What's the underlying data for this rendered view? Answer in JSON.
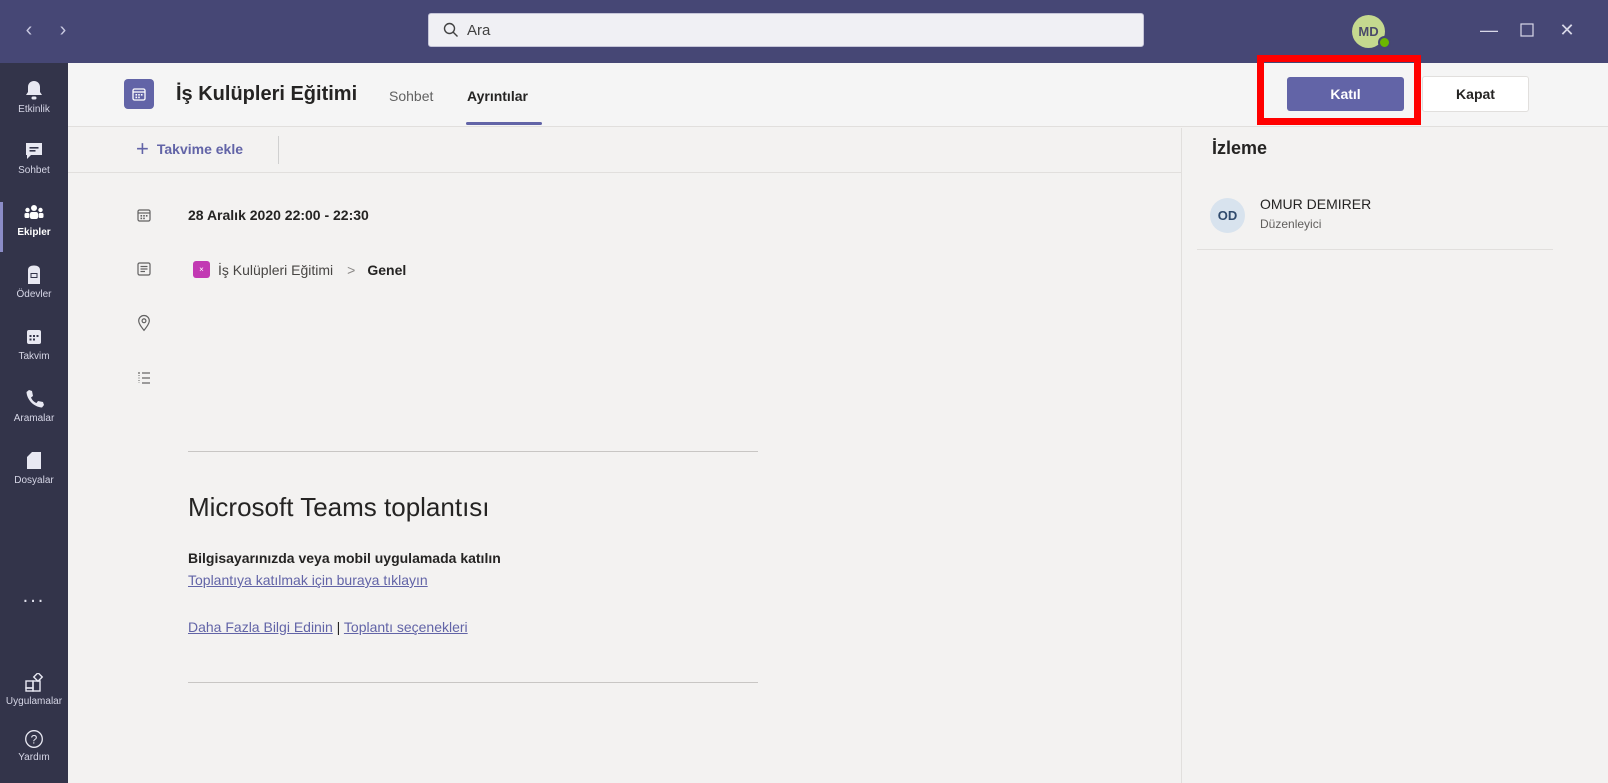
{
  "titlebar": {
    "search_placeholder": "Ara",
    "avatar_initials": "MD"
  },
  "rail": {
    "items": [
      {
        "label": "Etkinlik",
        "icon": "bell-icon"
      },
      {
        "label": "Sohbet",
        "icon": "chat-icon"
      },
      {
        "label": "Ekipler",
        "icon": "teams-icon",
        "active": true
      },
      {
        "label": "Ödevler",
        "icon": "assignments-icon"
      },
      {
        "label": "Takvim",
        "icon": "calendar-icon"
      },
      {
        "label": "Aramalar",
        "icon": "phone-icon"
      },
      {
        "label": "Dosyalar",
        "icon": "file-icon"
      }
    ],
    "more": "...",
    "apps_label": "Uygulamalar",
    "help_label": "Yardım"
  },
  "header": {
    "title": "İş Kulüpleri Eğitimi",
    "tabs": [
      "Sohbet",
      "Ayrıntılar"
    ],
    "active_tab": "Ayrıntılar",
    "join_label": "Katıl",
    "close_label": "Kapat"
  },
  "toolbar": {
    "add_calendar_label": "Takvime ekle"
  },
  "details": {
    "datetime": "28 Aralık 2020 22:00 - 22:30",
    "team_name": "İş Kulüpleri Eğitimi",
    "channel_name": "Genel"
  },
  "body": {
    "teams_title": "Microsoft Teams toplantısı",
    "join_description": "Bilgisayarınızda veya mobil uygulamada katılın",
    "join_link": "Toplantıya katılmak için buraya tıklayın",
    "more_info_link": "Daha Fazla Bilgi Edinin",
    "separator": " | ",
    "meeting_options_link": "Toplantı seçenekleri"
  },
  "tracking": {
    "title": "İzleme",
    "people": [
      {
        "initials": "OD",
        "name": "OMUR DEMIRER",
        "role": "Düzenleyici"
      }
    ]
  },
  "colors": {
    "titlebar": "#464775",
    "rail": "#33344a",
    "accent": "#6264a7",
    "highlight": "#ff0000"
  }
}
